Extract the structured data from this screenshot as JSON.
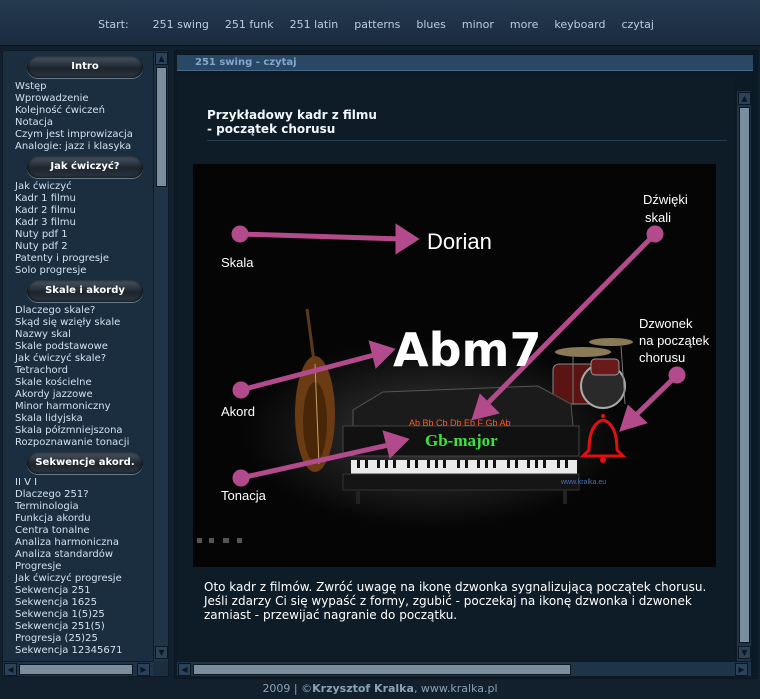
{
  "nav": {
    "label": "Start:",
    "items": [
      "251 swing",
      "251 funk",
      "251 latin",
      "patterns",
      "blues",
      "minor",
      "more",
      "keyboard",
      "czytaj"
    ]
  },
  "sidebar": {
    "sections": [
      {
        "title": "Intro",
        "links": [
          "Wstęp",
          "Wprowadzenie",
          "Kolejność ćwiczeń",
          "Notacja",
          "Czym jest improwizacja",
          "Analogie: jazz i klasyka"
        ]
      },
      {
        "title": "Jak ćwiczyć?",
        "links": [
          "Jak ćwiczyć",
          "Kadr 1 filmu",
          "Kadr 2 filmu",
          "Kadr 3 filmu",
          "Nuty pdf 1",
          "Nuty pdf 2",
          "Patenty i progresje",
          "Solo progresje"
        ]
      },
      {
        "title": "Skale i akordy",
        "links": [
          "Dlaczego skale?",
          "Skąd się wzięły skale",
          "Nazwy skal",
          "Skale podstawowe",
          "Jak ćwiczyć skale?",
          "Tetrachord",
          "Skale kościelne",
          "Akordy jazzowe",
          "Minor harmoniczny",
          "Skala lidyjska",
          "Skala półzmniejszona",
          "Rozpoznawanie tonacji"
        ]
      },
      {
        "title": "Sekwencje akord.",
        "links": [
          "II V I",
          "Dlaczego 251?",
          "Terminologia",
          "Funkcja akordu",
          "Centra tonalne",
          "Analiza harmoniczna",
          "Analiza standardów",
          "Progresje",
          "Jak ćwiczyć progresje",
          "Sekwencja 251",
          "Sekwencja 1625",
          "Sekwencja 1(5)25",
          "Sekwencja 251(5)",
          "Progresja (25)25",
          "Sekwencja 12345671"
        ]
      }
    ]
  },
  "main": {
    "tab_title": "251 swing - czytaj",
    "heading_line1": "Przykładowy kadr z filmu",
    "heading_line2": "- początek chorusu",
    "description_p1": "Oto kadr z filmów. Zwróć uwagę na ikonę dzwonka sygnalizującą początek chorusu.",
    "description_p2": "Jeśli zdarzy Ci się wypaść z formy, zgubić - poczekaj na ikonę dzwonka i dzwonek zamiast - przewijać nagranie do początku."
  },
  "frame": {
    "label_skala": "Skala",
    "label_akord": "Akord",
    "label_tonacja": "Tonacja",
    "label_dzwieki_1": "Dźwięki",
    "label_dzwieki_2": "skali",
    "label_dzwonek_1": "Dzwonek",
    "label_dzwonek_2": "na początek",
    "label_dzwonek_3": "chorusu",
    "scale_name": "Dorian",
    "chord_name": "Abm7",
    "notes": "Ab Bb Cb Db Eb F Gb Ab",
    "key_name": "Gb-major",
    "watermark": "www.kralka.eu",
    "colors": {
      "arrow": "#b24a8c",
      "key": "#3ce33c",
      "notes": "#ff5a1f",
      "bell": "#e01010"
    }
  },
  "footer": {
    "year": "2009 | ©",
    "author": "Krzysztof Kralka",
    "site": ", www.kralka.pl"
  }
}
